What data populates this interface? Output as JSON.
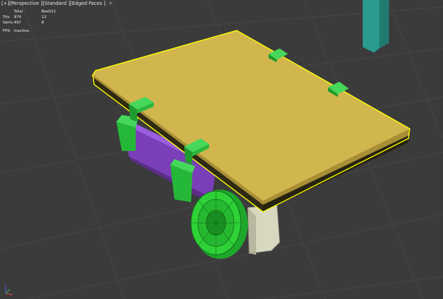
{
  "viewport": {
    "label_parts": [
      "[+]",
      "[Perspective ]",
      "[Standard ]",
      "[Edged Faces ]"
    ],
    "funnel_icon": "filter-icon"
  },
  "stats": {
    "headers": [
      "",
      "Total",
      "Box011"
    ],
    "rows": [
      {
        "label": "Tris:",
        "total": "974",
        "selected": "12"
      },
      {
        "label": "Verts:",
        "total": "497",
        "selected": "8"
      }
    ],
    "fps_label": "FPS:",
    "fps_value": "Inactive"
  },
  "colors": {
    "background": "#3b3b3b",
    "grid": "#4a4a4a",
    "board_top": "#d1b64e",
    "board_side": "#a88f35",
    "selection_outline": "#ffff00",
    "bracket": "#26c43a",
    "battery": "#8a4ec9",
    "wheel": "#2ed136",
    "motor": "#dcdcc8",
    "pillar": "#2a9c8f"
  }
}
